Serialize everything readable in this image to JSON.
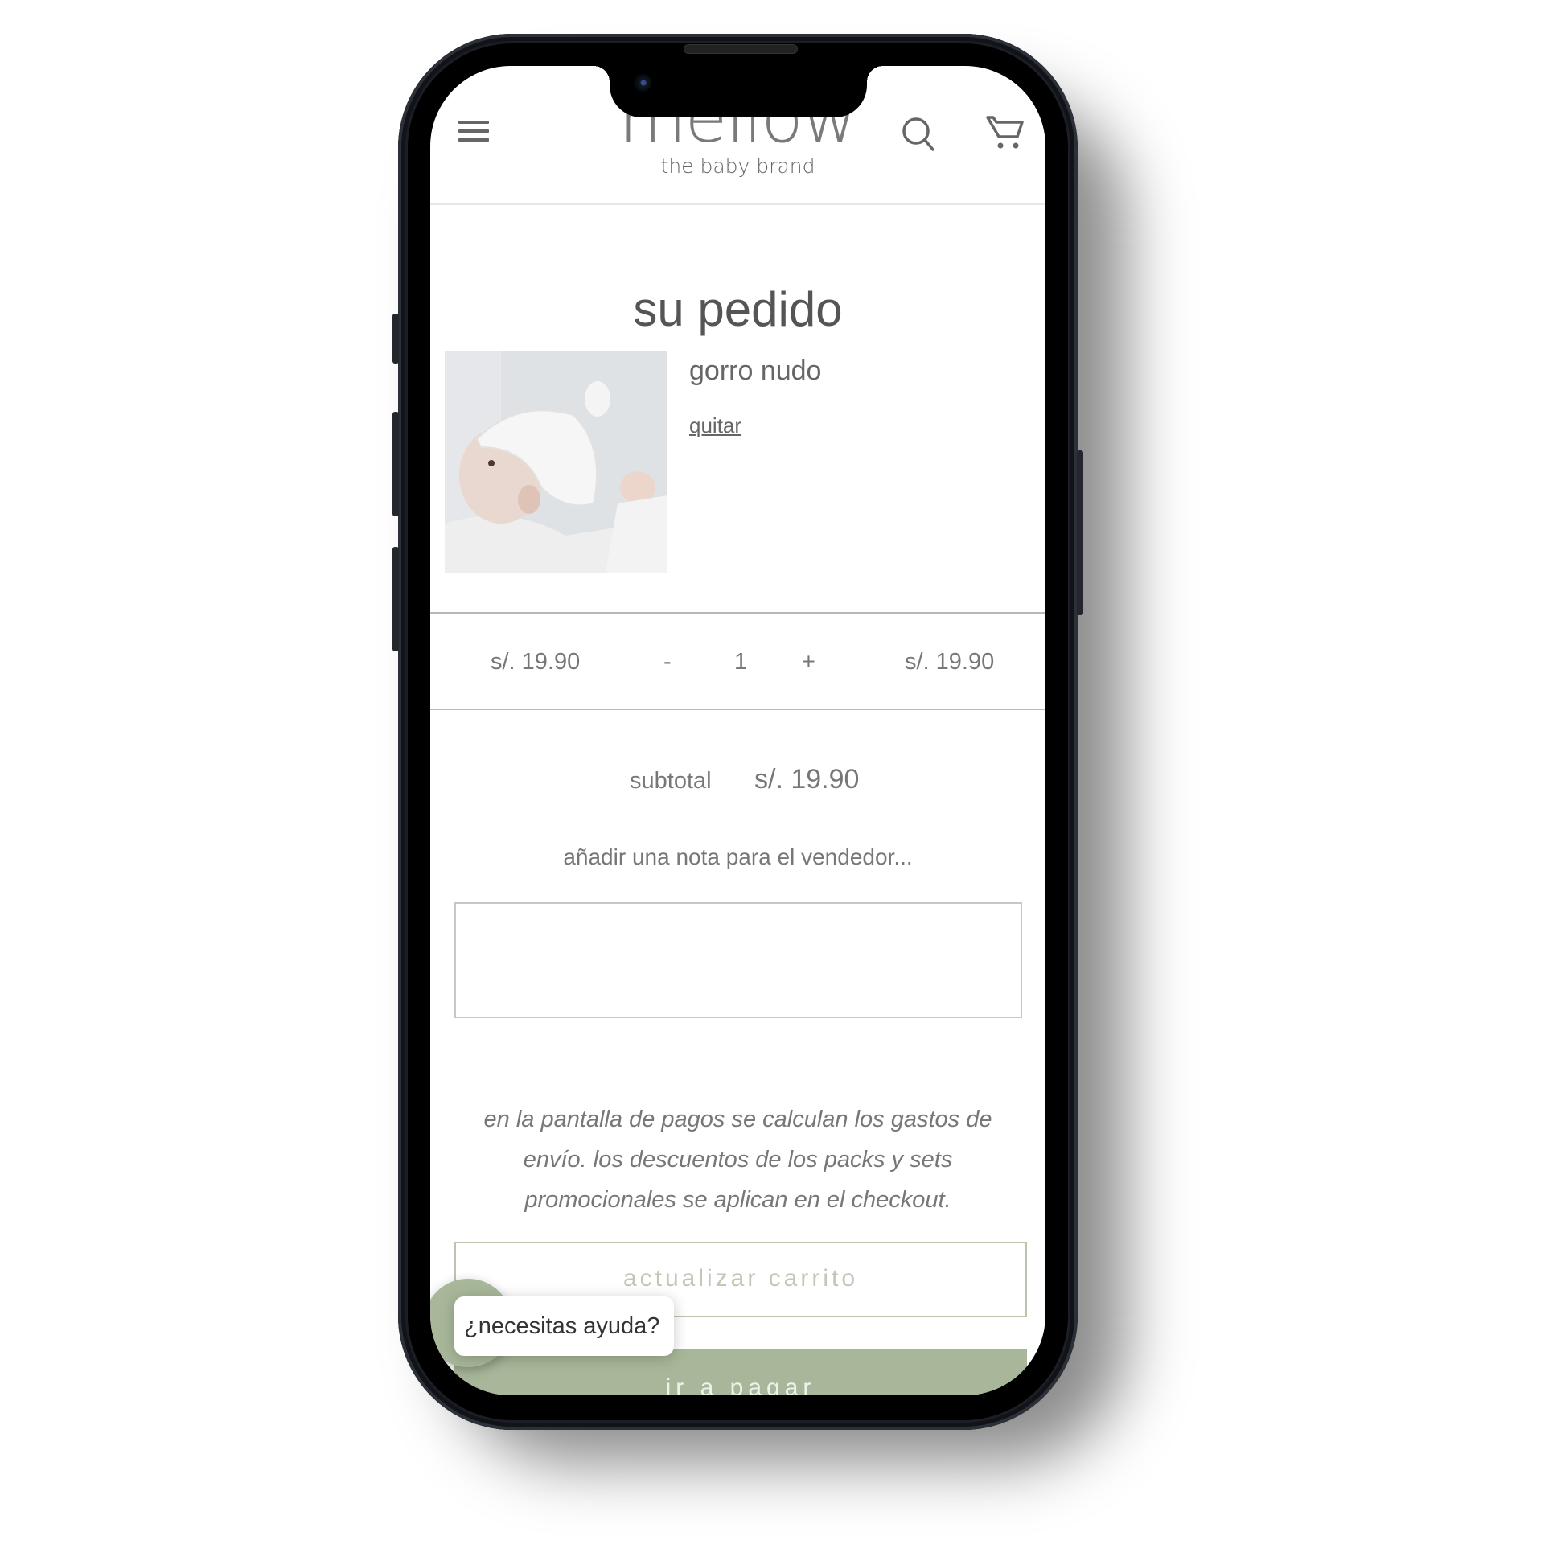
{
  "header": {
    "brand": "mellow",
    "tagline": "the baby brand",
    "icons": [
      "menu-icon",
      "search-icon",
      "cart-icon"
    ]
  },
  "cart": {
    "title": "su pedido",
    "items": [
      {
        "name": "gorro nudo",
        "remove_label": "quitar",
        "unit_price": "s/. 19.90",
        "quantity": "1",
        "decrement_label": "-",
        "increment_label": "+",
        "line_total": "s/. 19.90"
      }
    ],
    "subtotal_label": "subtotal",
    "subtotal_value": "s/. 19.90",
    "note_label": "añadir una nota para el vendedor...",
    "note_value": "",
    "info_text": "en la pantalla de pagos se calculan los gastos de envío. los descuentos de los packs y sets promocionales se aplican en el checkout.",
    "update_button": "actualizar carrito",
    "checkout_button": "ir a pagar"
  },
  "help_widget": {
    "label": "¿necesitas ayuda?"
  },
  "colors": {
    "accent_green": "#a8b799",
    "text_gray": "#777777"
  }
}
